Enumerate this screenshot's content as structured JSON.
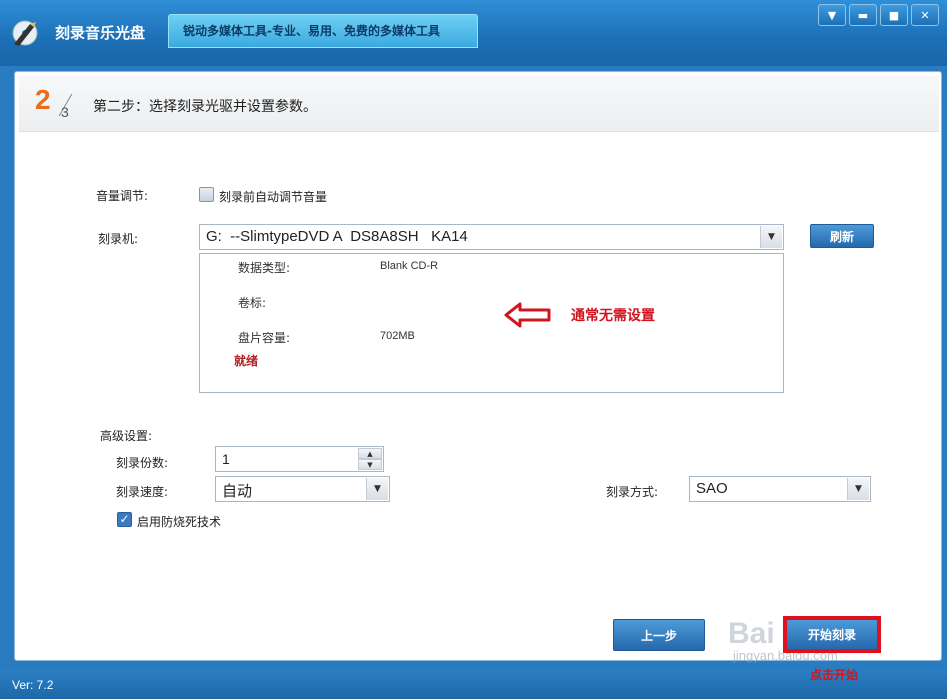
{
  "app": {
    "title": "刻录音乐光盘",
    "slogan": "锐动多媒体工具-专业、易用、免费的多媒体工具",
    "icon": "music-cd-burn-icon",
    "window_buttons": [
      "menu-down-icon",
      "minimize-icon",
      "maximize-icon",
      "close-icon"
    ]
  },
  "step": {
    "current": "2",
    "total": "3",
    "text": "第二步：选择刻录光驱并设置参数。"
  },
  "volume": {
    "label": "音量调节:",
    "checkbox_label": "刻录前自动调节音量",
    "checked": false
  },
  "burner": {
    "label": "刻录机:",
    "selected": "G:  --SlimtypeDVD A  DS8A8SH   KA14",
    "refresh_label": "刷新"
  },
  "disc_info": {
    "type_label": "数据类型:",
    "type_value": "Blank CD-R",
    "volume_label": "卷标:",
    "volume_value": "",
    "capacity_label": "盘片容量:",
    "capacity_value": "702MB",
    "status": "就绪"
  },
  "annotation": {
    "text": "通常无需设置",
    "color": "#d2141e"
  },
  "advanced": {
    "label": "高级设置:",
    "copies_label": "刻录份数:",
    "copies_value": "1",
    "speed_label": "刻录速度:",
    "speed_value": "自动",
    "mode_label": "刻录方式:",
    "mode_value": "SAO",
    "burnproof_label": "启用防烧死技术",
    "burnproof_checked": true
  },
  "footer": {
    "prev_label": "上一步",
    "start_label": "开始刻录",
    "start_caption": "点击开始",
    "version": "Ver: 7.2"
  },
  "watermark": {
    "text": "Bai du经验",
    "url": "jingyan.baidu.com"
  },
  "colors": {
    "accent": "#2569ad",
    "step_number": "#ea6d1c",
    "highlight": "#e0101e"
  }
}
